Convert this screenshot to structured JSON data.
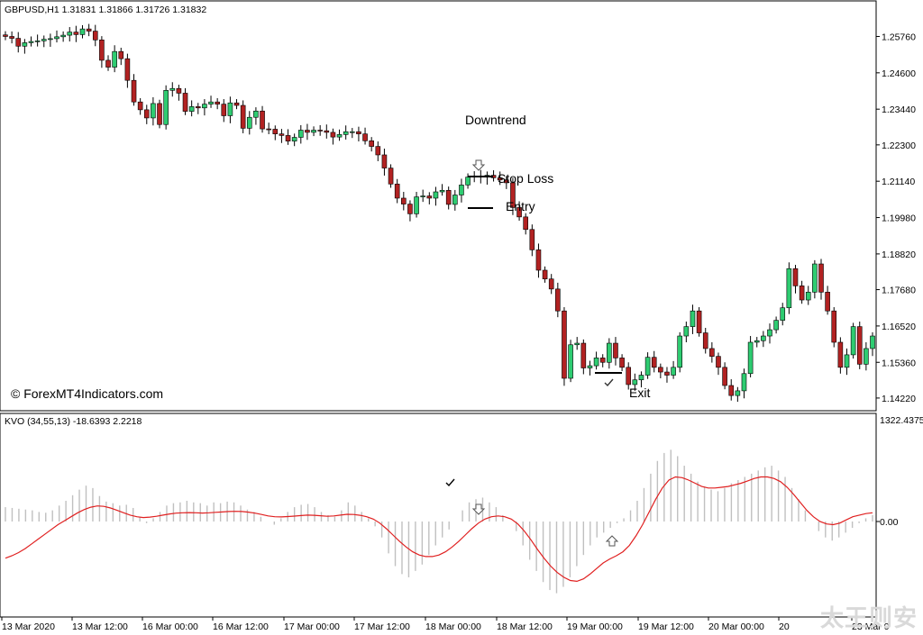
{
  "main_panel": {
    "symbol_header": "GBPUSD,H1  1.31831 1.31866 1.31726 1.31832",
    "copyright": "© ForexMT4Indicators.com",
    "annotations": {
      "trend": "Downtrend",
      "stop_loss": "Stop Loss",
      "entry": "Entry",
      "exit": "Exit"
    },
    "price_ticks": [
      "1.25760",
      "1.24600",
      "1.23440",
      "1.22300",
      "1.21140",
      "1.19980",
      "1.18820",
      "1.17680",
      "1.16520",
      "1.15360",
      "1.14220"
    ]
  },
  "indicator_panel": {
    "header": "KVO (34,55,13)  -18.6393 2.2218",
    "top_value": "1322.4375",
    "zero_label": "0.00"
  },
  "time_axis": [
    "13 Mar 2020",
    "13 Mar 12:00",
    "16 Mar 00:00",
    "16 Mar 12:00",
    "17 Mar 00:00",
    "17 Mar 12:00",
    "18 Mar 00:00",
    "18 Mar 12:00",
    "19 Mar 00:00",
    "19 Mar 12:00",
    "20 Mar 00:00",
    "20",
    "23 Mar 0"
  ],
  "watermark": "太王则安",
  "colors": {
    "bull": "#2ecc71",
    "bear": "#b22222",
    "signal": "#e02020",
    "hist": "#c0c0c0",
    "frame": "#000000"
  },
  "chart_data": [
    {
      "type": "candlestick",
      "title": "GBPUSD,H1",
      "ylim": [
        1.1393,
        1.2678
      ],
      "y_ticks": [
        1.2576,
        1.246,
        1.2344,
        1.223,
        1.2114,
        1.1998,
        1.1882,
        1.1768,
        1.1652,
        1.1536,
        1.1422
      ],
      "close": [
        1.2576,
        1.257,
        1.2545,
        1.2556,
        1.256,
        1.2562,
        1.2567,
        1.2569,
        1.2575,
        1.258,
        1.259,
        1.2582,
        1.26,
        1.2593,
        1.2565,
        1.25,
        1.2478,
        1.2528,
        1.2505,
        1.2436,
        1.2367,
        1.2342,
        1.2316,
        1.2362,
        1.2295,
        1.2404,
        1.241,
        1.2395,
        1.2337,
        1.2352,
        1.2348,
        1.236,
        1.2367,
        1.236,
        1.2323,
        1.2364,
        1.2356,
        1.2283,
        1.2318,
        1.2338,
        1.2281,
        1.228,
        1.2265,
        1.226,
        1.2242,
        1.2254,
        1.2277,
        1.227,
        1.2277,
        1.2275,
        1.227,
        1.2255,
        1.2263,
        1.2272,
        1.2272,
        1.2265,
        1.2243,
        1.2225,
        1.2198,
        1.2156,
        1.2105,
        1.206,
        1.2041,
        1.201,
        1.2064,
        1.2067,
        1.206,
        1.208,
        1.2085,
        1.204,
        1.207,
        1.2102,
        1.2127,
        1.213,
        1.2127,
        1.2133,
        1.2125,
        1.2118,
        1.2109,
        1.203,
        1.2,
        1.196,
        1.1895,
        1.183,
        1.1802,
        1.177,
        1.17,
        1.1485,
        1.1592,
        1.1597,
        1.1518,
        1.1525,
        1.155,
        1.1536,
        1.1597,
        1.155,
        1.152,
        1.1465,
        1.148,
        1.1495,
        1.1552,
        1.152,
        1.1505,
        1.1495,
        1.152,
        1.162,
        1.165,
        1.17,
        1.163,
        1.158,
        1.1555,
        1.152,
        1.1462,
        1.143,
        1.1445,
        1.15,
        1.16,
        1.1605,
        1.162,
        1.164,
        1.167,
        1.171,
        1.1835,
        1.178,
        1.1735,
        1.176,
        1.185,
        1.176,
        1.17,
        1.16,
        1.152,
        1.156,
        1.165,
        1.153,
        1.158,
        1.162
      ],
      "volume_ticks_note": ""
    },
    {
      "type": "line",
      "title": "KVO (34,55,13)",
      "ylim": [
        -1322.4375,
        1322.4375
      ],
      "histogram": [
        180,
        170,
        160,
        150,
        140,
        120,
        110,
        140,
        200,
        260,
        330,
        400,
        450,
        420,
        320,
        250,
        230,
        200,
        210,
        170,
        60,
        -20,
        40,
        120,
        200,
        230,
        240,
        260,
        240,
        230,
        200,
        240,
        230,
        250,
        240,
        200,
        150,
        120,
        60,
        0,
        -40,
        40,
        120,
        180,
        210,
        220,
        180,
        120,
        80,
        60,
        140,
        240,
        200,
        120,
        40,
        -60,
        -200,
        -400,
        -560,
        -660,
        -700,
        -620,
        -540,
        -420,
        -300,
        -200,
        -100,
        0,
        140,
        240,
        280,
        300,
        240,
        180,
        80,
        0,
        -120,
        -300,
        -480,
        -620,
        -760,
        -860,
        -900,
        -820,
        -700,
        -560,
        -420,
        -300,
        -200,
        -140,
        -80,
        -20,
        40,
        140,
        260,
        420,
        600,
        760,
        860,
        900,
        820,
        700,
        600,
        500,
        440,
        400,
        380,
        420,
        480,
        520,
        560,
        600,
        640,
        680,
        700,
        640,
        560,
        420,
        280,
        140,
        0,
        -120,
        -200,
        -240,
        -200,
        -140,
        -80,
        -20,
        40,
        80
      ],
      "signal": [
        -460,
        -430,
        -390,
        -340,
        -280,
        -220,
        -160,
        -100,
        -40,
        10,
        60,
        110,
        150,
        180,
        195,
        190,
        170,
        140,
        110,
        80,
        60,
        50,
        55,
        65,
        80,
        95,
        105,
        110,
        112,
        110,
        106,
        110,
        115,
        120,
        125,
        128,
        125,
        118,
        105,
        88,
        70,
        60,
        58,
        62,
        68,
        75,
        80,
        78,
        72,
        66,
        70,
        80,
        90,
        88,
        78,
        60,
        30,
        -20,
        -90,
        -170,
        -250,
        -320,
        -380,
        -420,
        -440,
        -440,
        -420,
        -380,
        -320,
        -250,
        -170,
        -90,
        -20,
        30,
        60,
        70,
        60,
        30,
        -30,
        -120,
        -230,
        -350,
        -460,
        -560,
        -640,
        -700,
        -740,
        -750,
        -720,
        -660,
        -590,
        -520,
        -470,
        -430,
        -380,
        -300,
        -180,
        -40,
        120,
        280,
        420,
        520,
        560,
        550,
        520,
        480,
        440,
        420,
        420,
        430,
        440,
        460,
        480,
        510,
        540,
        560,
        560,
        540,
        500,
        430,
        340,
        240,
        140,
        60,
        0,
        -30,
        -40,
        -20,
        20,
        60,
        80,
        100,
        110
      ]
    }
  ]
}
